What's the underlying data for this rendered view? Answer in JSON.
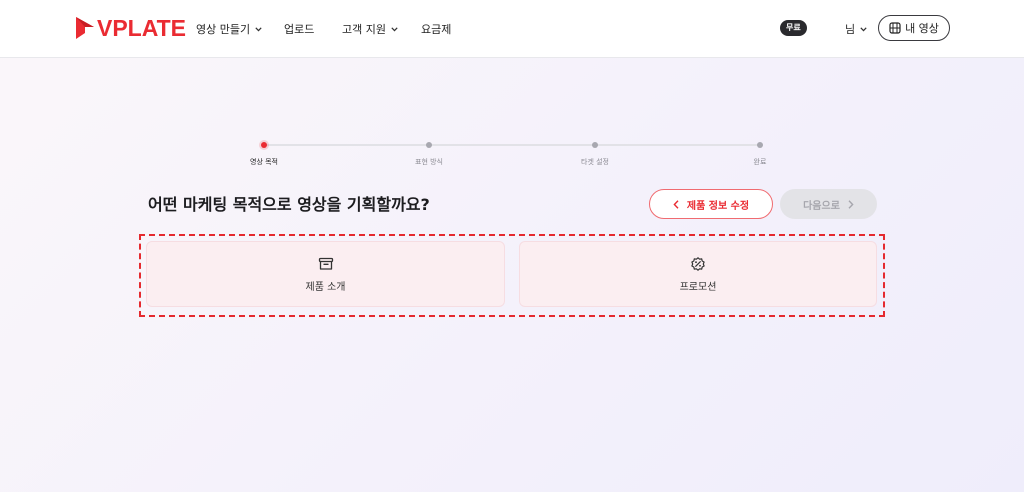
{
  "header": {
    "logo_text": "VPLATE",
    "nav": [
      {
        "label": "영상 만들기",
        "has_dropdown": true
      },
      {
        "label": "업로드",
        "has_dropdown": false
      },
      {
        "label": "고객 지원",
        "has_dropdown": true
      },
      {
        "label": "요금제",
        "has_dropdown": false
      }
    ],
    "plan_badge": "무료",
    "user_label": "님",
    "my_video_label": "내 영상"
  },
  "stepper": {
    "steps": [
      {
        "label": "영상 목적",
        "active": true
      },
      {
        "label": "표현 방식",
        "active": false
      },
      {
        "label": "타겟 설정",
        "active": false
      },
      {
        "label": "완료",
        "active": false
      }
    ]
  },
  "main": {
    "title": "어떤 마케팅 목적으로 영상을 기획할까요?",
    "edit_button_label": "제품 정보 수정",
    "next_button_label": "다음으로",
    "options": [
      {
        "label": "제품 소개",
        "icon": "box-icon"
      },
      {
        "label": "프로모션",
        "icon": "discount-icon"
      }
    ]
  },
  "colors": {
    "brand": "#ea2b32",
    "card_background": "#fbeef1",
    "disabled_button": "#e3e3e7",
    "highlight_border": "#e52a2f"
  }
}
